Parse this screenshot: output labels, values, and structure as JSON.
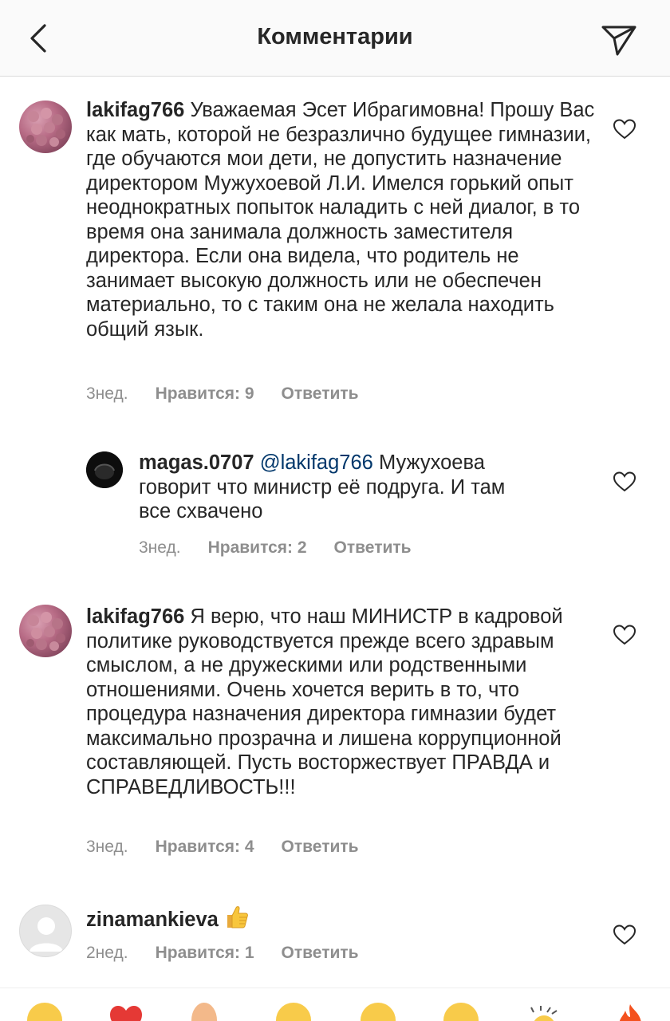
{
  "header": {
    "title": "Комментарии"
  },
  "comments": [
    {
      "username": "lakifag766",
      "text": "Уважаемая Эсет Ибрагимовна! Прошу Вас как мать, которой не безразлично будущее гимназии,  где обучаются мои дети, не допустить назначение директором Мужухоевой Л.И. Имелся горький опыт неоднократных  попыток наладить с ней диалог, в то время она занимала  должность заместителя директора. Если она видела, что родитель не занимает высокую должность или не обеспечен материально, то с таким она не желала находить общий язык.",
      "time": "3нед.",
      "likes": "Нравится: 9",
      "reply": "Ответить"
    },
    {
      "username": "magas.0707",
      "mention": "@lakifag766",
      "text": "Мужухоева говорит что министр её подруга. И там все схвачено",
      "time": "3нед.",
      "likes": "Нравится: 2",
      "reply": "Ответить"
    },
    {
      "username": "lakifag766",
      "text": "Я верю, что наш МИНИСТР  в кадровой  политике руководствуется прежде всего здравым смыслом, а не дружескими или родственными отношениями. Очень хочется верить в то, что процедура назначения директора гимназии будет максимально прозрачна и лишена коррупционной составляющей. Пусть восторжествует ПРАВДА и СПРАВЕДЛИВОСТЬ!!!",
      "time": "3нед.",
      "likes": "Нравится: 4",
      "reply": "Ответить"
    },
    {
      "username": "zinamankieva",
      "emoji": "thumbs-up",
      "time": "2нед.",
      "likes": "Нравится: 1",
      "reply": "Ответить"
    }
  ],
  "emoji_bar": [
    "smiley",
    "red-heart",
    "raised-hands",
    "smiley",
    "smiley",
    "smiley",
    "party",
    "fire"
  ],
  "colors": {
    "text": "#262626",
    "meta": "#8e8e8e",
    "mention": "#00376b",
    "header_bg": "#fafafa"
  }
}
